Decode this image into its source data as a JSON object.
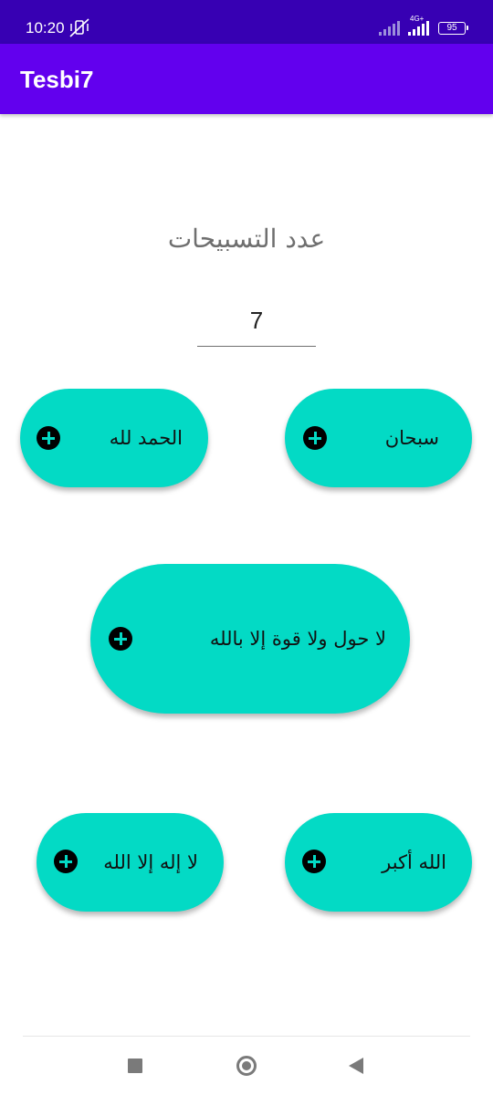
{
  "status_bar": {
    "time": "10:20",
    "network_label": "4G+",
    "battery": "95",
    "icons": [
      "mute-vibrate-icon",
      "signal-icon",
      "signal-4g-icon",
      "battery-icon"
    ]
  },
  "app_bar": {
    "title": "Tesbi7"
  },
  "counter": {
    "label": "عدد التسبيحات",
    "value": "7"
  },
  "buttons": {
    "subhan": "سبحان",
    "alhamdulillah": "الحمد لله",
    "la_hawla": "لا حول ولا قوة إلا بالله",
    "allahu_akbar": "الله أكبر",
    "la_ilaha": "لا إله إلا الله"
  },
  "colors": {
    "status_bar": "#3700b3",
    "app_bar": "#6200ee",
    "button": "#03dac5",
    "icon": "#000000"
  },
  "nav_bar": {
    "icons": [
      "recents-square-icon",
      "home-circle-icon",
      "back-triangle-icon"
    ]
  }
}
